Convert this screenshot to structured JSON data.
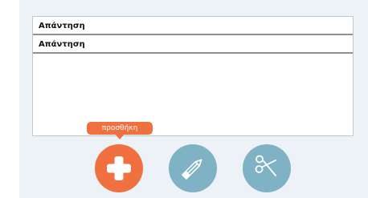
{
  "answers": [
    {
      "label": "Απάντηση"
    },
    {
      "label": "Απάντηση"
    }
  ],
  "actions": {
    "add": {
      "tooltip": "προσθήκη",
      "icon": "plus-icon",
      "color": "#f0703f"
    },
    "edit": {
      "icon": "pencil-icon",
      "color": "#7fb2c4"
    },
    "cut": {
      "icon": "scissors-icon",
      "color": "#7fb2c4"
    }
  },
  "colors": {
    "panel_bg": "#edf2f7",
    "accent": "#f0703f",
    "secondary": "#7fb2c4"
  }
}
